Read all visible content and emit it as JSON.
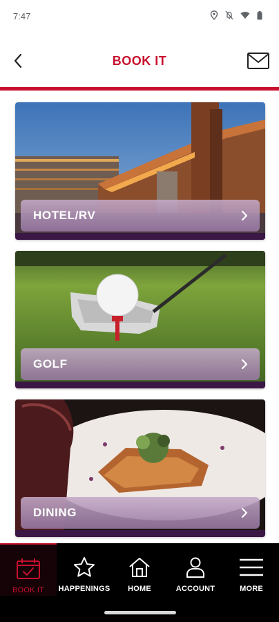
{
  "status_bar": {
    "time": "7:47",
    "icons": [
      "location-icon",
      "no-notifications-icon",
      "wifi-icon",
      "battery-icon"
    ]
  },
  "header": {
    "title": "BOOK IT",
    "back_icon": "chevron-left-icon",
    "mail_icon": "envelope-icon"
  },
  "cards": [
    {
      "label": "HOTEL/RV",
      "image": "resort-hotel-building-photo"
    },
    {
      "label": "GOLF",
      "image": "golf-ball-and-driver-photo"
    },
    {
      "label": "DINING",
      "image": "salmon-plate-photo"
    }
  ],
  "bottom_nav": {
    "items": [
      {
        "label": "BOOK IT",
        "icon": "calendar-check-icon",
        "active": true
      },
      {
        "label": "HAPPENINGS",
        "icon": "star-icon",
        "active": false
      },
      {
        "label": "HOME",
        "icon": "house-icon",
        "active": false
      },
      {
        "label": "ACCOUNT",
        "icon": "person-icon",
        "active": false
      },
      {
        "label": "MORE",
        "icon": "hamburger-menu-icon",
        "active": false
      }
    ]
  },
  "colors": {
    "accent": "#c8102e",
    "card_strip": "#3b1745",
    "nav_background": "#000000"
  }
}
